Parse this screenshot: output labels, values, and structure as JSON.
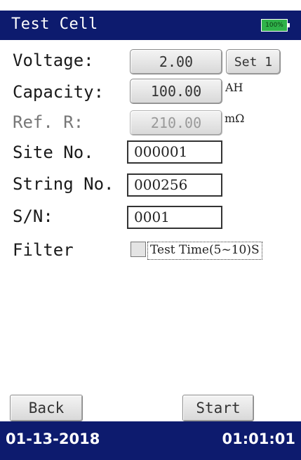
{
  "header": {
    "title": "Test Cell",
    "battery_label": "100%",
    "battery_color": "#2fb24a",
    "bar_color": "#0d1b6e"
  },
  "form": {
    "voltage": {
      "label": "Voltage:",
      "value": "2.00",
      "set_button": "Set 1"
    },
    "capacity": {
      "label": "Capacity:",
      "value": "100.00",
      "unit": "AH"
    },
    "ref_r": {
      "label": "Ref. R:",
      "value": "210.00",
      "unit": "mΩ"
    },
    "site_no": {
      "label": "Site No.",
      "value": "000001"
    },
    "string_no": {
      "label": "String No.",
      "value": "000256"
    },
    "sn": {
      "label": "S/N:",
      "value": "0001"
    },
    "filter": {
      "label": "Filter",
      "checked": false,
      "test_time_label": "Test Time(5~10)S"
    }
  },
  "actions": {
    "back_label": "Back",
    "start_label": "Start"
  },
  "status": {
    "date": "01-13-2018",
    "time": "01:01:01"
  }
}
